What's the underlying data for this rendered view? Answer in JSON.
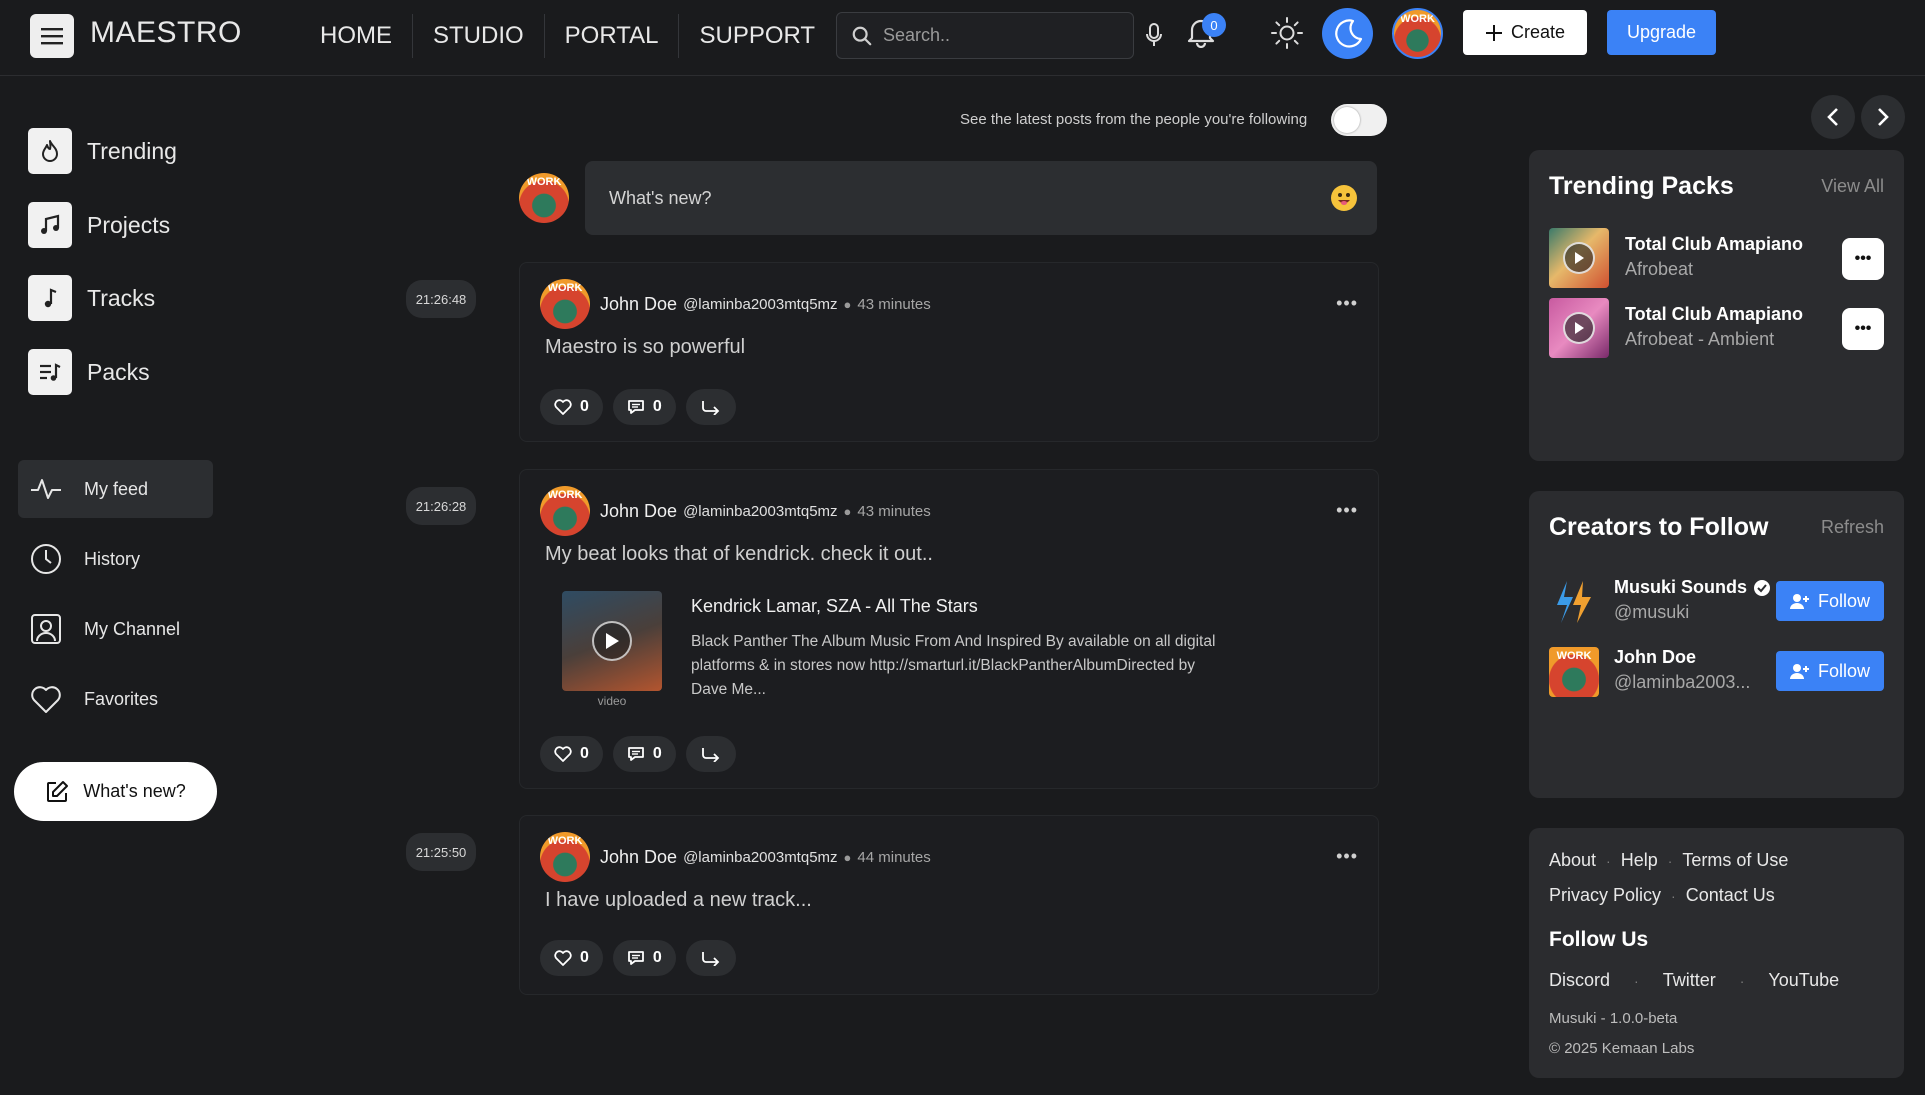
{
  "header": {
    "logo": "MAESTRO",
    "nav": [
      "HOME",
      "STUDIO",
      "PORTAL",
      "SUPPORT"
    ],
    "search_placeholder": "Search..",
    "notification_count": "0",
    "create_label": "Create",
    "upgrade_label": "Upgrade",
    "avatar_text": "WORK"
  },
  "sidebar": {
    "main_items": [
      {
        "label": "Trending",
        "icon": "flame-icon"
      },
      {
        "label": "Projects",
        "icon": "music-notes-icon"
      },
      {
        "label": "Tracks",
        "icon": "music-note-icon"
      },
      {
        "label": "Packs",
        "icon": "playlist-icon"
      }
    ],
    "feed_items": [
      {
        "label": "My feed",
        "icon": "activity-icon"
      },
      {
        "label": "History",
        "icon": "clock-icon"
      },
      {
        "label": "My Channel",
        "icon": "user-square-icon"
      },
      {
        "label": "Favorites",
        "icon": "heart-icon"
      }
    ],
    "whats_new_button": "What's new?"
  },
  "feed": {
    "following_toggle_text": "See the latest posts from the people you're following",
    "compose_placeholder": "What's new?",
    "timestamps": [
      "21:26:48",
      "21:26:28",
      "21:25:50"
    ],
    "posts": [
      {
        "author": "John Doe",
        "handle": "@laminba2003mtq5mz",
        "time": "43 minutes",
        "text": "Maestro is so powerful",
        "likes": "0",
        "comments": "0"
      },
      {
        "author": "John Doe",
        "handle": "@laminba2003mtq5mz",
        "time": "43 minutes",
        "text": "My beat looks that of kendrick. check it out..",
        "likes": "0",
        "comments": "0",
        "media": {
          "title": "Kendrick Lamar, SZA - All The Stars",
          "description": "Black Panther The Album Music From And Inspired By available on all digital platforms & in stores now http://smarturl.it/BlackPantherAlbumDirected by Dave Me...",
          "caption": "video"
        }
      },
      {
        "author": "John Doe",
        "handle": "@laminba2003mtq5mz",
        "time": "44 minutes",
        "text": "I have uploaded a new track...",
        "likes": "0",
        "comments": "0"
      }
    ]
  },
  "right": {
    "trending": {
      "title": "Trending Packs",
      "view_all": "View All",
      "packs": [
        {
          "title": "Total Club Amapiano",
          "subtitle": "Afrobeat"
        },
        {
          "title": "Total Club Amapiano",
          "subtitle": "Afrobeat - Ambient"
        }
      ]
    },
    "creators": {
      "title": "Creators to Follow",
      "refresh": "Refresh",
      "follow_label": "Follow",
      "list": [
        {
          "name": "Musuki Sounds",
          "handle": "@musuki",
          "verified": true
        },
        {
          "name": "John Doe",
          "handle": "@laminba2003...",
          "verified": false
        }
      ]
    },
    "footer": {
      "links_row1": [
        "About",
        "Help",
        "Terms of Use"
      ],
      "links_row2": [
        "Privacy Policy",
        "Contact Us"
      ],
      "follow_us": "Follow Us",
      "socials": [
        "Discord",
        "Twitter",
        "YouTube"
      ],
      "version": "Musuki - 1.0.0-beta",
      "copyright": "© 2025 Kemaan Labs"
    }
  },
  "colors": {
    "background": "#1a1b1d",
    "card": "#2b2c2f",
    "accent": "#3b82f6"
  }
}
